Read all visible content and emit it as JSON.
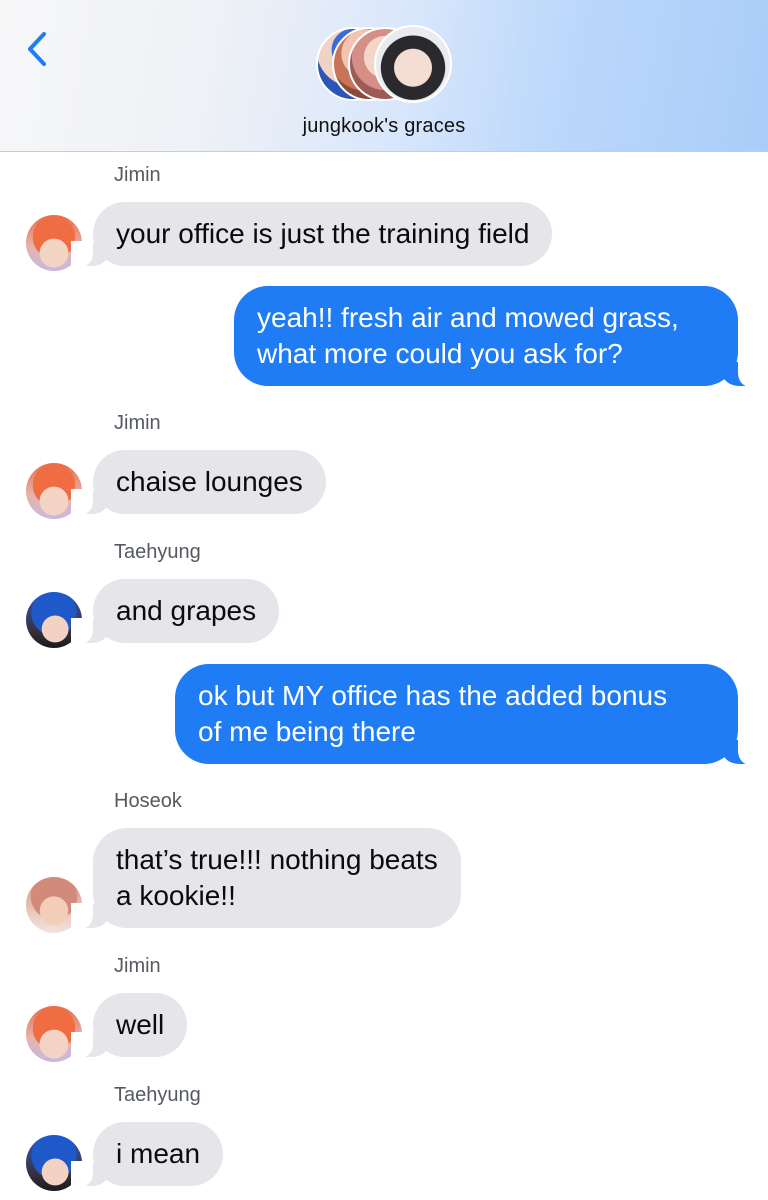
{
  "header": {
    "back_icon": "chevron-left-icon",
    "group_name": "jungkook's graces",
    "accent_color": "#1f7cf5"
  },
  "messages": [
    {
      "sender": "Jimin",
      "direction": "incoming",
      "text": [
        "your office is just the training field"
      ]
    },
    {
      "sender": "",
      "direction": "outgoing",
      "text": [
        "yeah!! fresh air and mowed grass,",
        "what more could you ask for?"
      ]
    },
    {
      "sender": "Jimin",
      "direction": "incoming",
      "text": [
        "chaise lounges"
      ]
    },
    {
      "sender": "Taehyung",
      "direction": "incoming",
      "text": [
        "and grapes"
      ]
    },
    {
      "sender": "",
      "direction": "outgoing",
      "text": [
        "ok but MY office has the added bonus",
        "of me being there"
      ]
    },
    {
      "sender": "Hoseok",
      "direction": "incoming",
      "text": [
        "that’s true!!! nothing beats",
        "a kookie!!"
      ]
    },
    {
      "sender": "Jimin",
      "direction": "incoming",
      "text": [
        "well"
      ]
    },
    {
      "sender": "Taehyung",
      "direction": "incoming",
      "text": [
        "i mean"
      ]
    }
  ],
  "colors": {
    "incoming_bubble": "#e5e5ea",
    "outgoing_bubble": "#1f7cf5"
  }
}
